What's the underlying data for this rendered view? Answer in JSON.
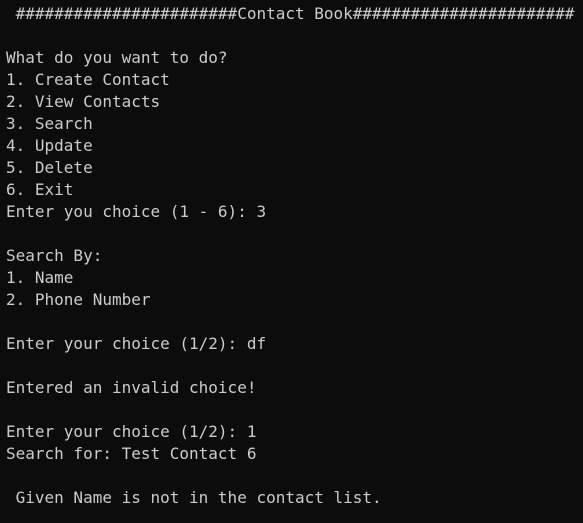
{
  "terminal": {
    "header": " #######################Contact Book#######################",
    "menu": {
      "prompt": "What do you want to do?",
      "options": [
        "1. Create Contact",
        "2. View Contacts",
        "3. Search",
        "4. Update",
        "5. Delete",
        "6. Exit"
      ],
      "choice_line": "Enter you choice (1 - 6): 3"
    },
    "search": {
      "title": "Search By:",
      "options": [
        "1. Name",
        "2. Phone Number"
      ],
      "first_choice_line": "Enter your choice (1/2): df",
      "error_line": "Entered an invalid choice!",
      "second_choice_line": "Enter your choice (1/2): 1",
      "query_line": "Search for: Test Contact 6",
      "result_line": " Given Name is not in the contact list."
    }
  }
}
